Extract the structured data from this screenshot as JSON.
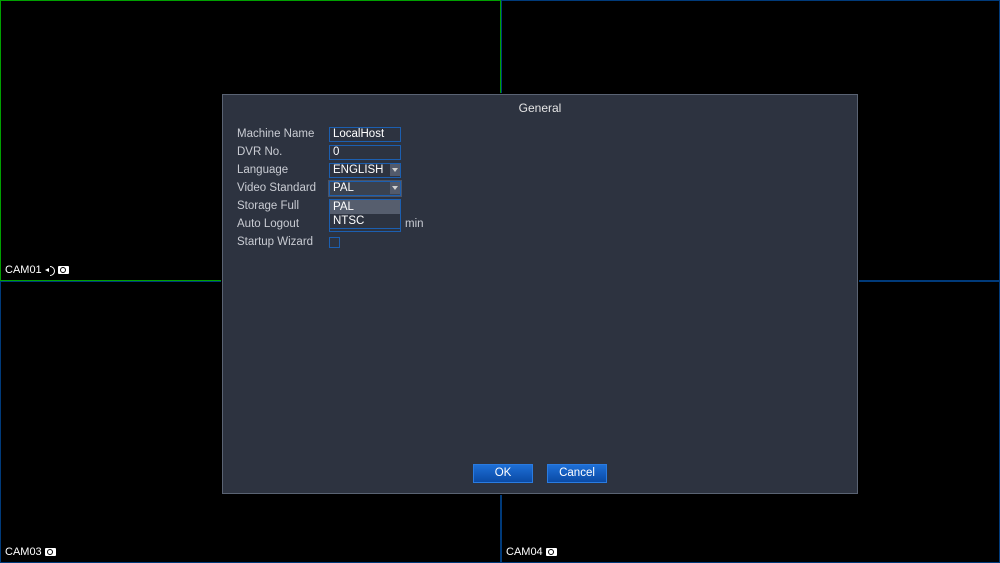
{
  "cameras": {
    "c1": "CAM01",
    "c3": "CAM03",
    "c4": "CAM04"
  },
  "dialog": {
    "title": "General",
    "labels": {
      "machine_name": "Machine Name",
      "dvr_no": "DVR No.",
      "language": "Language",
      "video_standard": "Video Standard",
      "storage_full": "Storage Full",
      "auto_logout": "Auto Logout",
      "startup_wizard": "Startup Wizard"
    },
    "values": {
      "machine_name": "LocalHost",
      "dvr_no": "0",
      "language": "ENGLISH",
      "video_standard": "PAL",
      "auto_logout_unit": "min"
    },
    "video_standard_options": {
      "o0": "PAL",
      "o1": "NTSC"
    },
    "buttons": {
      "ok": "OK",
      "cancel": "Cancel"
    }
  }
}
